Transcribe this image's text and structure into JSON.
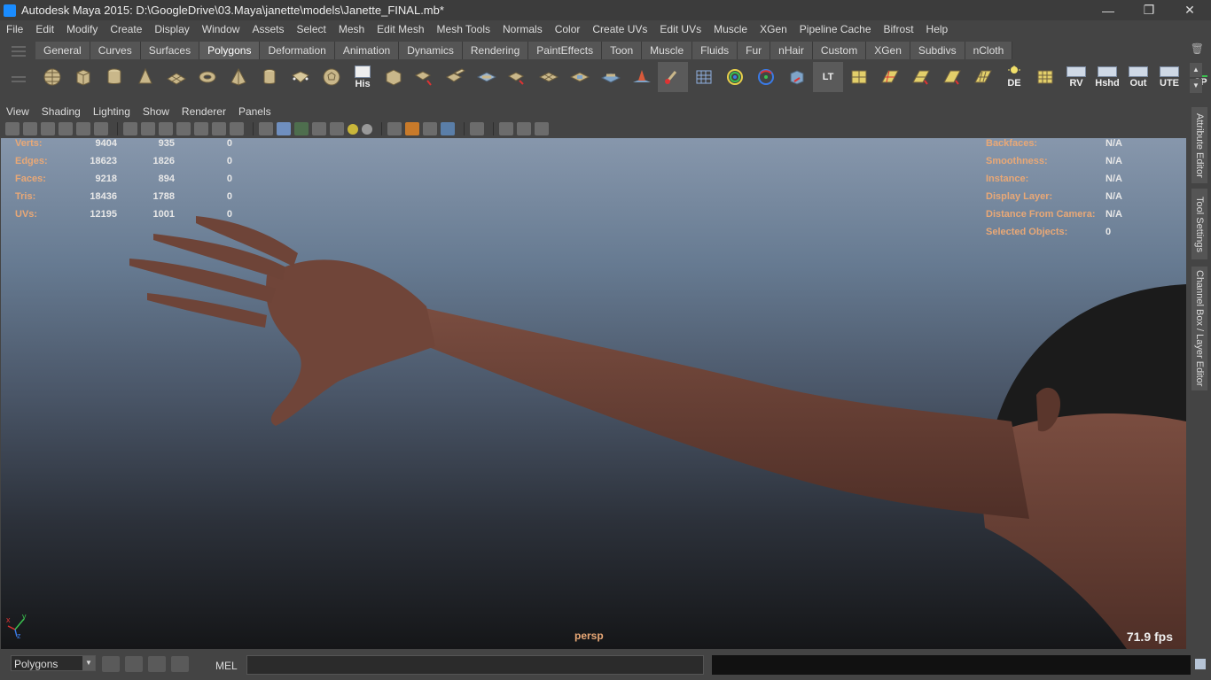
{
  "window": {
    "title": "Autodesk Maya 2015: D:\\GoogleDrive\\03.Maya\\janette\\models\\Janette_FINAL.mb*",
    "minimize": "—",
    "restore": "❐",
    "close": "✕"
  },
  "menubar": [
    "File",
    "Edit",
    "Modify",
    "Create",
    "Display",
    "Window",
    "Assets",
    "Select",
    "Mesh",
    "Edit Mesh",
    "Mesh Tools",
    "Normals",
    "Color",
    "Create UVs",
    "Edit UVs",
    "Muscle",
    "XGen",
    "Pipeline Cache",
    "Bifrost",
    "Help"
  ],
  "shelf": {
    "tabs": [
      "General",
      "Curves",
      "Surfaces",
      "Polygons",
      "Deformation",
      "Animation",
      "Dynamics",
      "Rendering",
      "PaintEffects",
      "Toon",
      "Muscle",
      "Fluids",
      "Fur",
      "nHair",
      "Custom",
      "XGen",
      "Subdivs",
      "nCloth"
    ],
    "active_tab": "Polygons",
    "icon_labels": {
      "his": "His",
      "lt": "LT",
      "de": "DE",
      "rv": "RV",
      "hshd": "Hshd",
      "out": "Out",
      "ute": "UTE",
      "cp": "CP"
    }
  },
  "panel_menu": [
    "View",
    "Shading",
    "Lighting",
    "Show",
    "Renderer",
    "Panels"
  ],
  "hud_left": {
    "rows": [
      {
        "label": "Verts:",
        "a": "9404",
        "b": "935",
        "c": "0"
      },
      {
        "label": "Edges:",
        "a": "18623",
        "b": "1826",
        "c": "0"
      },
      {
        "label": "Faces:",
        "a": "9218",
        "b": "894",
        "c": "0"
      },
      {
        "label": "Tris:",
        "a": "18436",
        "b": "1788",
        "c": "0"
      },
      {
        "label": "UVs:",
        "a": "12195",
        "b": "1001",
        "c": "0"
      }
    ]
  },
  "hud_right": {
    "rows": [
      {
        "label": "Backfaces:",
        "value": "N/A"
      },
      {
        "label": "Smoothness:",
        "value": "N/A"
      },
      {
        "label": "Instance:",
        "value": "N/A"
      },
      {
        "label": "Display Layer:",
        "value": "N/A"
      },
      {
        "label": "Distance From Camera:",
        "value": "N/A"
      },
      {
        "label": "Selected Objects:",
        "value": "0"
      }
    ]
  },
  "viewport": {
    "camera": "persp",
    "fps": "71.9 fps",
    "axis_x": "x",
    "axis_y": "y",
    "axis_z": "z"
  },
  "side_tabs": [
    "Attribute Editor",
    "Tool Settings",
    "Channel Box / Layer Editor"
  ],
  "bottom": {
    "mode": "Polygons",
    "mel_label": "MEL"
  },
  "colors": {
    "hud_label": "#e9a876",
    "skin": "#6a4237",
    "hair": "#1a1a1a"
  }
}
